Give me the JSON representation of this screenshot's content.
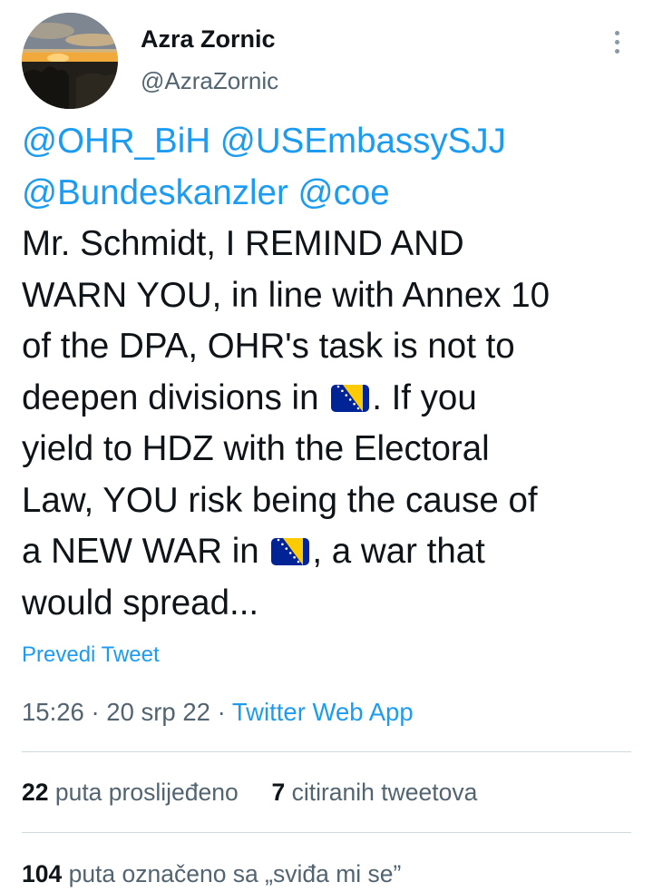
{
  "user": {
    "display_name": "Azra Zornic",
    "handle": "@AzraZornic"
  },
  "tweet": {
    "lines": [
      [
        {
          "text": "@OHR_BiH",
          "kind": "mention"
        },
        {
          "text": " ",
          "kind": "text"
        },
        {
          "text": "@USEmbassySJJ",
          "kind": "mention"
        }
      ],
      [
        {
          "text": "@Bundeskanzler",
          "kind": "mention"
        },
        {
          "text": " ",
          "kind": "text"
        },
        {
          "text": "@coe",
          "kind": "mention"
        }
      ],
      [
        {
          "text": "Mr. Schmidt, I REMIND AND",
          "kind": "text"
        }
      ],
      [
        {
          "text": "WARN YOU, in line with Annex 10",
          "kind": "text"
        }
      ],
      [
        {
          "text": "of the DPA, OHR's task is not to",
          "kind": "text"
        }
      ],
      [
        {
          "text": "deepen divisions in ",
          "kind": "text"
        },
        {
          "text": "flag-ba",
          "kind": "emoji"
        },
        {
          "text": ". If you",
          "kind": "text"
        }
      ],
      [
        {
          "text": "yield to HDZ with the Electoral",
          "kind": "text"
        }
      ],
      [
        {
          "text": "Law, YOU risk being the cause of",
          "kind": "text"
        }
      ],
      [
        {
          "text": "a NEW WAR in ",
          "kind": "text"
        },
        {
          "text": "flag-ba",
          "kind": "emoji"
        },
        {
          "text": ", a war that",
          "kind": "text"
        }
      ],
      [
        {
          "text": "would spread...",
          "kind": "text"
        }
      ]
    ]
  },
  "translate_label": "Prevedi Tweet",
  "meta": {
    "time": "15:26",
    "sep1": " · ",
    "date": "20 srp 22",
    "sep2": " · ",
    "source": "Twitter Web App"
  },
  "stats": {
    "retweets_count": "22",
    "retweets_label": " puta proslijeđeno",
    "quotes_count": "7",
    "quotes_label": " citiranih tweetova",
    "likes_count": "104",
    "likes_label": " puta označeno sa „sviđa mi se”"
  },
  "colors": {
    "link": "#1d9bf0",
    "secondary_text": "#536471",
    "primary_text": "#0f1419",
    "divider": "#cfd9de",
    "flag_blue": "#002395",
    "flag_yellow": "#fecb00"
  },
  "icons": {
    "more": "more-vertical-icon",
    "flag": "bosnia-flag-emoji"
  }
}
